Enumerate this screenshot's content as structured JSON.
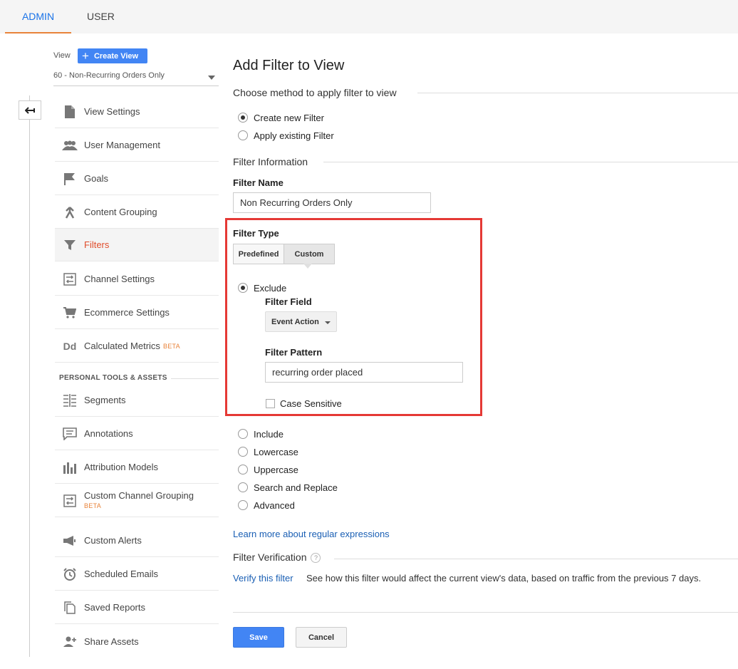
{
  "tabs": {
    "admin": "ADMIN",
    "user": "USER"
  },
  "sidebar": {
    "view_label": "View",
    "create_view_label": "Create View",
    "selected_view": "60 - Non-Recurring Orders Only",
    "items": [
      {
        "label": "View Settings",
        "icon": "document-icon"
      },
      {
        "label": "User Management",
        "icon": "people-icon"
      },
      {
        "label": "Goals",
        "icon": "flag-icon"
      },
      {
        "label": "Content Grouping",
        "icon": "merge-icon"
      },
      {
        "label": "Filters",
        "icon": "filter-icon"
      },
      {
        "label": "Channel Settings",
        "icon": "channel-icon"
      },
      {
        "label": "Ecommerce Settings",
        "icon": "cart-icon"
      },
      {
        "label": "Calculated Metrics",
        "icon": "dd-icon",
        "badge": "BETA"
      }
    ],
    "section_title": "PERSONAL TOOLS & ASSETS",
    "tools": [
      {
        "label": "Segments",
        "icon": "segments-icon"
      },
      {
        "label": "Annotations",
        "icon": "comment-icon"
      },
      {
        "label": "Attribution Models",
        "icon": "bars-icon"
      },
      {
        "label": "Custom Channel Grouping",
        "icon": "channel-icon",
        "badge": "BETA"
      },
      {
        "label": "Custom Alerts",
        "icon": "megaphone-icon"
      },
      {
        "label": "Scheduled Emails",
        "icon": "alarm-icon"
      },
      {
        "label": "Saved Reports",
        "icon": "copy-icon"
      },
      {
        "label": "Share Assets",
        "icon": "person-add-icon"
      }
    ]
  },
  "main": {
    "title": "Add Filter to View",
    "method_heading": "Choose method to apply filter to view",
    "method_options": [
      "Create new Filter",
      "Apply existing Filter"
    ],
    "info_heading": "Filter Information",
    "filter_name_label": "Filter Name",
    "filter_name_value": "Non Recurring Orders Only",
    "filter_type_label": "Filter Type",
    "type_tabs": [
      "Predefined",
      "Custom"
    ],
    "exclude_label": "Exclude",
    "filter_field_label": "Filter Field",
    "filter_field_value": "Event Action",
    "filter_pattern_label": "Filter Pattern",
    "filter_pattern_value": "recurring order placed",
    "case_sensitive_label": "Case Sensitive",
    "other_options": [
      "Include",
      "Lowercase",
      "Uppercase",
      "Search and Replace",
      "Advanced"
    ],
    "learn_more": "Learn more about regular expressions",
    "verification_heading": "Filter Verification",
    "help_glyph": "?",
    "verify_link": "Verify this filter",
    "verify_desc": "See how this filter would affect the current view's data, based on traffic from the previous 7 days.",
    "save_label": "Save",
    "cancel_label": "Cancel"
  },
  "colors": {
    "accent": "#4285f4",
    "active_nav": "#e04d2b",
    "tab_underline": "#e8833a",
    "highlight": "#e53935"
  }
}
